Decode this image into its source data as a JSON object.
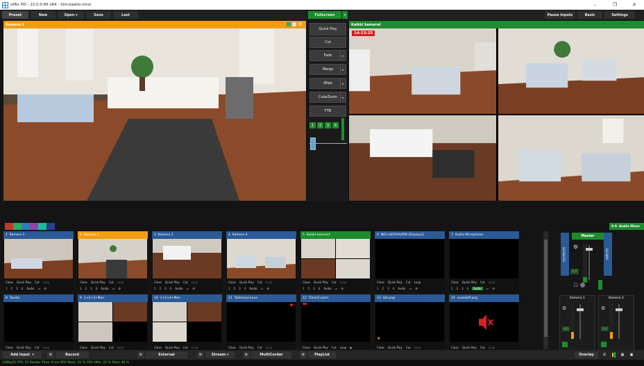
{
  "window": {
    "title": "vMix HD - 22.0.0.66 x64 - Simulaatio.vmix"
  },
  "menu": {
    "preset": "Preset",
    "new": "New",
    "open": "Open",
    "save": "Save",
    "last": "Last",
    "fullscreen": "Fullscreen",
    "pause_inputs": "Pause Inputs",
    "basic": "Basic",
    "settings": "Settings"
  },
  "preview": {
    "label": "Kamera 2"
  },
  "output": {
    "label": "Kaikki kamerat",
    "timecode": "14:13:25"
  },
  "transitions": {
    "quick_play": "Quick Play",
    "cut": "Cut",
    "fade": "Fade",
    "merge": "Merge",
    "wipe": "Wipe",
    "cubezoom": "CubeZoom",
    "ftb": "FTB",
    "numbers": [
      "1",
      "2",
      "3",
      "4"
    ]
  },
  "colors": {
    "accent_green": "#1e8c2e",
    "preview_orange": "#f39c12",
    "input_blue": "#2b5a96",
    "swatches": [
      "#c0392b",
      "#27ae60",
      "#2980b9",
      "#8e44ad",
      "#1abc9c",
      "#2c3e8f"
    ]
  },
  "inputs": [
    {
      "num": "1",
      "name": "Kamera 1",
      "state": "normal"
    },
    {
      "num": "2",
      "name": "Kamera 2",
      "state": "preview"
    },
    {
      "num": "3",
      "name": "Kamera 3",
      "state": "normal"
    },
    {
      "num": "4",
      "name": "Kamera 4",
      "state": "normal"
    },
    {
      "num": "5",
      "name": "Kaikki kamerat",
      "state": "live"
    },
    {
      "num": "6",
      "name": "NDI LAEROAUPW (Display1)",
      "state": "normal"
    },
    {
      "num": "7",
      "name": "Audio Microphone",
      "state": "normal"
    },
    {
      "num": "8",
      "name": "Taustа",
      "state": "normal"
    },
    {
      "num": "9",
      "name": "1+2+3+Man",
      "state": "normal"
    },
    {
      "num": "10",
      "name": "1+2+4+Man",
      "state": "normal"
    },
    {
      "num": "11",
      "name": "Tallennus-kuva",
      "state": "normal"
    },
    {
      "num": "12",
      "name": "Timer2.xaml",
      "state": "normal"
    },
    {
      "num": "13",
      "name": "dot.png",
      "state": "normal"
    },
    {
      "num": "14",
      "name": "soundoff.png",
      "state": "normal"
    }
  ],
  "tile_labels": {
    "close": "Close",
    "quick_play": "Quick Play",
    "cut": "Cut",
    "loop": "Loop",
    "audio": "Audio",
    "nums": [
      "1",
      "2",
      "3",
      "4"
    ]
  },
  "audio": {
    "master": "Master",
    "outputs": "OUTPUTS",
    "inputs": "INPUTS",
    "ch1": "Kamera 1",
    "ch2": "Kamera 2",
    "header": "Audio Mixer",
    "header_tag": "0.0",
    "db": "0.0"
  },
  "bottom": {
    "add_input": "Add Input",
    "record": "Record",
    "external": "External",
    "stream": "Stream",
    "multicorder": "MultiCorder",
    "playlist": "PlayList",
    "overlay": "Overlay"
  },
  "status": {
    "text": "1080p25   FPS: 25  Render Time: 6 ms  GPU Mem: 31 %  CPU vMix: 22 %  Total: 40 %"
  }
}
